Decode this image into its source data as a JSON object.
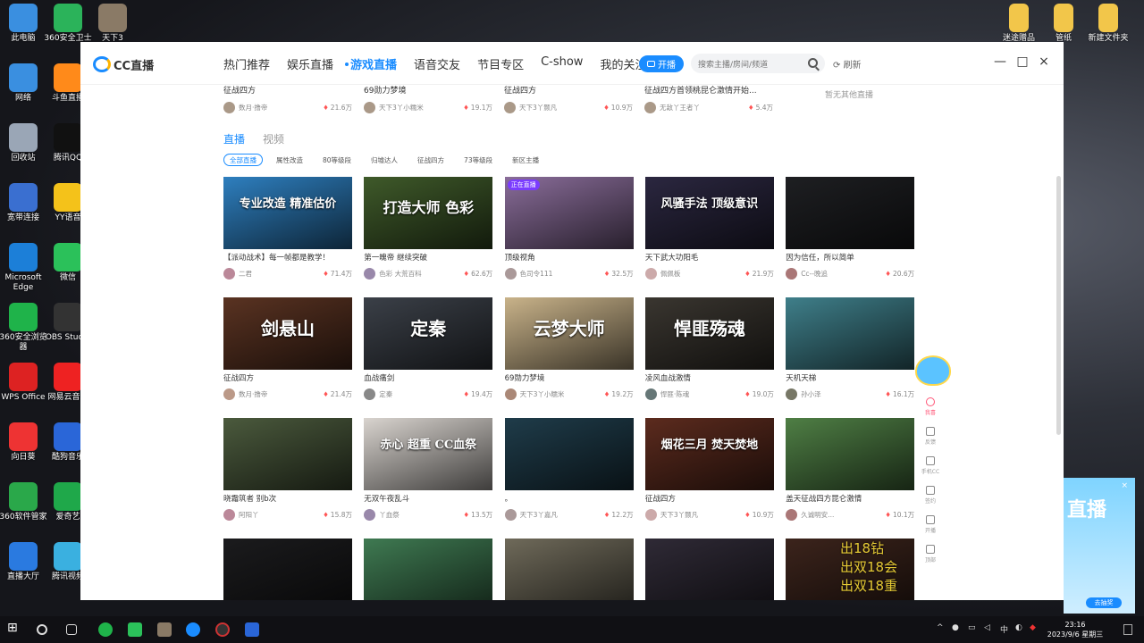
{
  "desktop": {
    "left_icons": [
      "此电脑",
      "360安全卫士",
      "天下3",
      "网络",
      "斗鱼直播",
      "回收站",
      "腾讯QQ",
      "宽带连接",
      "YY语音",
      "Microsoft Edge",
      "微信",
      "360安全浏览器",
      "OBS Studio",
      "WPS Office",
      "网易云音乐",
      "向日葵",
      "酷狗音乐",
      "360软件管家",
      "爱奇艺",
      "直播大厅",
      "腾讯视频"
    ],
    "right_icons": [
      "迷途赠品",
      "管纸",
      "新建文件夹"
    ]
  },
  "browser": {
    "logo": "CC直播",
    "nav": [
      "热门推荐",
      "娱乐直播",
      "游戏直播",
      "语音交友",
      "节目专区",
      "C-show",
      "我的关注"
    ],
    "active_nav": "游戏直播",
    "open_button": "开播",
    "search_placeholder": "搜索主播/房间/频道",
    "refresh": "刷新",
    "window_controls": [
      "—",
      "□",
      "×"
    ]
  },
  "prev_row": [
    {
      "title": "征战四方",
      "user": "数月·撸帝",
      "views": "21.6万"
    },
    {
      "title": "69勋力梦境",
      "user": "天下3丫小糯米",
      "views": "19.1万"
    },
    {
      "title": "征战四方",
      "user": "天下3丫颢凡",
      "views": "10.9万"
    },
    {
      "title": "征战四方首领桃昆仑激情开始...",
      "user": "无敌丫王者丫",
      "views": "5.4万"
    },
    {
      "title": "暂无其他直播",
      "user": "",
      "views": ""
    }
  ],
  "tabs": [
    "直播",
    "视频"
  ],
  "active_tab": "直播",
  "chips": [
    "全部直播",
    "属性改造",
    "80等级段",
    "归墟达人",
    "征战四方",
    "73等级段",
    "新区主播"
  ],
  "cards": [
    {
      "title": "【派动战术】每一帧都是教学！",
      "user": "二君",
      "views": "71.4万",
      "overlay": "专业改造 精准估价",
      "bg": "#2e7fbf"
    },
    {
      "title": "第一魄帝 继续突破",
      "user": "色彩 大荒百科",
      "views": "62.6万",
      "overlay": "打造大师 色彩",
      "bg": "#3f5a2a"
    },
    {
      "title": "顶级视角",
      "user": "色司令111",
      "views": "32.5万",
      "overlay": "",
      "bg": "#8a6d9a",
      "badge": "正在直播"
    },
    {
      "title": "天下武大功阳毛",
      "user": "佩佩板",
      "views": "21.9万",
      "overlay": "风骚手法 顶级意识",
      "bg": "#2b2740"
    },
    {
      "title": "因为信任，所以简单",
      "user": "Cc--晚追",
      "views": "20.6万",
      "overlay": "",
      "bg": "#1e1f22"
    },
    {
      "title": "征战四方",
      "user": "数月·撸帝",
      "views": "21.4万",
      "overlay": "剑悬山",
      "bg": "#5a3322"
    },
    {
      "title": "血战痛剑",
      "user": "定秦",
      "views": "19.4万",
      "overlay": "定秦",
      "bg": "#3b4048"
    },
    {
      "title": "69勋力梦境",
      "user": "天下3丫小糯米",
      "views": "19.2万",
      "overlay": "云梦大师",
      "bg": "#c9b38a"
    },
    {
      "title": "凌风血战激情",
      "user": "悍匪·陈魂",
      "views": "19.0万",
      "overlay": "悍匪殇魂",
      "bg": "#3a3630"
    },
    {
      "title": "天机天梯",
      "user": "孙小泽",
      "views": "16.1万",
      "overlay": "",
      "bg": "#3f7f8a"
    },
    {
      "title": "晓霜筑者 别b次",
      "user": "阿阳丫",
      "views": "15.8万",
      "overlay": "",
      "bg": "#4b5a3d"
    },
    {
      "title": "无双午夜乱斗",
      "user": "丫血祭",
      "views": "13.5万",
      "overlay": "赤心 超重 CC血祭",
      "bg": "#d9d4cf"
    },
    {
      "title": "。",
      "user": "天下3丫嘉凡",
      "views": "12.2万",
      "overlay": "",
      "bg": "#1f3c4a"
    },
    {
      "title": "征战四方",
      "user": "天下3丫颢凡",
      "views": "10.9万",
      "overlay": "烟花三月 焚天焚地",
      "bg": "#5c2b1e"
    },
    {
      "title": "盖天征战四方昆仑激情",
      "user": "久诚明安...",
      "views": "10.1万",
      "overlay": "",
      "bg": "#4f7f45"
    },
    {
      "title": "",
      "user": "",
      "views": "",
      "overlay": "",
      "bg": "#1b1b1d"
    },
    {
      "title": "",
      "user": "",
      "views": "",
      "overlay": "",
      "bg": "#3f7a52"
    },
    {
      "title": "",
      "user": "",
      "views": "",
      "overlay": "",
      "bg": "#6f6a5a"
    },
    {
      "title": "",
      "user": "",
      "views": "",
      "overlay": "",
      "bg": "#2f2a36"
    },
    {
      "title": "",
      "user": "",
      "views": "",
      "overlay": "",
      "bg": "#3c241c"
    }
  ],
  "float_tools": [
    "我喜",
    "反馈",
    "手机CC",
    "签约",
    "开播",
    "顶部"
  ],
  "popup": {
    "big": "直播",
    "button": "去抽奖"
  },
  "overlay_lines": [
    "出18钻",
    "出双18会",
    "出双18重"
  ],
  "taskbar": {
    "time": "23:16",
    "date": "2023/9/6 星期三",
    "ime": "中"
  }
}
